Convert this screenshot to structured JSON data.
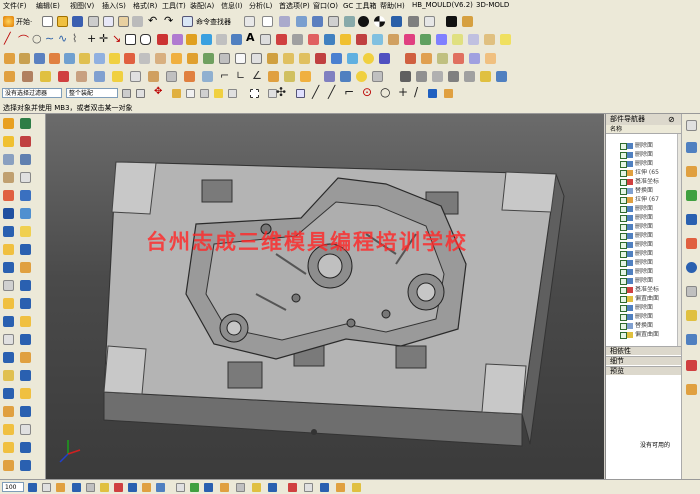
{
  "menu": {
    "items": [
      "文件(F)",
      "编辑(E)",
      "视图(V)",
      "插入(S)",
      "格式(R)",
      "工具(T)",
      "装配(A)",
      "信息(I)",
      "分析(L)",
      "首选项(P)",
      "窗口(O)",
      "GC 工具箱",
      "帮助(H)",
      "HB_MOULD(V6.2)",
      "3D-MOLD"
    ]
  },
  "toolbar": {
    "start_label": "开始·",
    "command_finder_label": "命令查找器"
  },
  "selection": {
    "filter_value": "没有选择过滤器",
    "assembly_value": "整个装配"
  },
  "status": {
    "prompt": "选择对象并使用 MB3，或者双击某一对象"
  },
  "viewport": {
    "watermark": "台州志成三维模具编程培训学校"
  },
  "navigator": {
    "title": "部件导航器",
    "column_header": "名称",
    "rows": [
      "删除面",
      "删除面",
      "删除面",
      "拉伸 (65",
      "基准坐标",
      "替换面",
      "拉伸 (67",
      "删除面",
      "删除面",
      "删除面",
      "删除面",
      "删除面",
      "删除面",
      "删除面",
      "删除面",
      "删除面",
      "基准坐标",
      "偏置曲面",
      "删除面",
      "删除面",
      "替换面",
      "偏置曲面"
    ],
    "sections": [
      "相依性",
      "细节",
      "预览"
    ],
    "preview_empty": "没有可用的"
  },
  "bottom": {
    "zoom_value": "100"
  },
  "colors": {
    "toolbar_bg": "#ece9d8",
    "viewport_bg": "#4a4a4a",
    "watermark": "#ff2828"
  }
}
